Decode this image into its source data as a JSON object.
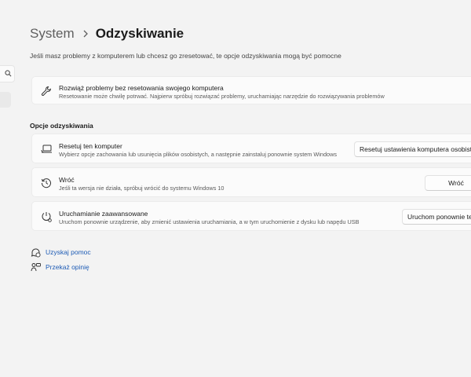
{
  "breadcrumb": {
    "parent": "System",
    "separator": "›",
    "current": "Odzyskiwanie"
  },
  "subtitle": "Jeśli masz problemy z komputerem lub chcesz go zresetować, te opcje odzyskiwania mogą być pomocne",
  "troubleshoot_card": {
    "title": "Rozwiąż problemy bez resetowania swojego komputera",
    "description": "Resetowanie może chwilę potrwać. Najpierw spróbuj rozwiązać problemy, uruchamiając narzędzie do rozwiązywania problemów",
    "icon": "wrench-icon"
  },
  "section_title": "Opcje odzyskiwania",
  "options": [
    {
      "title": "Resetuj ten komputer",
      "description": "Wybierz opcje zachowania lub usunięcia plików osobistych, a następnie zainstaluj ponownie system Windows",
      "button": "Resetuj ustawienia komputera osobistego",
      "icon": "reset-pc-icon"
    },
    {
      "title": "Wróć",
      "description": "Jeśli ta wersja nie działa, spróbuj wrócić do systemu Windows 10",
      "button": "Wróć",
      "icon": "history-icon"
    },
    {
      "title": "Uruchamianie zaawansowane",
      "description": "Uruchom ponownie urządzenie, aby zmienić ustawienia uruchamiania, a w tym uruchomienie z dysku lub napędu USB",
      "button": "Uruchom ponownie teraz",
      "icon": "advanced-startup-icon"
    }
  ],
  "links": [
    {
      "label": "Uzyskaj pomoc",
      "icon": "help-icon"
    },
    {
      "label": "Przekaż opinię",
      "icon": "feedback-icon"
    }
  ],
  "colors": {
    "background": "#f3f3f3",
    "card": "#fbfbfb",
    "link": "#1d5bb5"
  }
}
